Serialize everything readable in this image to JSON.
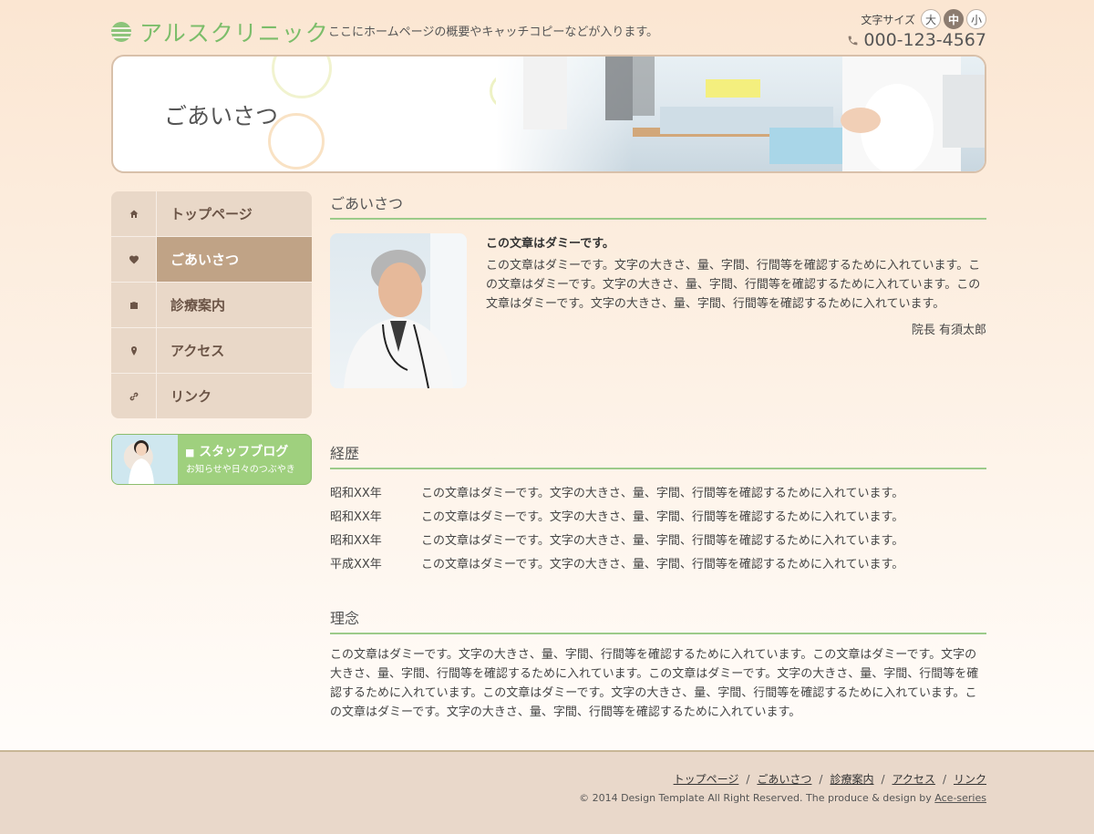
{
  "header": {
    "logo_text": "アルスクリニック",
    "catch_copy": "ここにホームページの概要やキャッチコピーなどが入ります。",
    "font_size_label": "文字サイズ",
    "font_sizes": [
      "大",
      "中",
      "小"
    ],
    "font_size_active": "中",
    "phone": "000-123-4567"
  },
  "banner": {
    "title": "ごあいさつ"
  },
  "nav": {
    "items": [
      {
        "label": "トップページ",
        "icon": "home-icon"
      },
      {
        "label": "ごあいさつ",
        "icon": "heart-icon",
        "current": true
      },
      {
        "label": "診療案内",
        "icon": "briefcase-icon"
      },
      {
        "label": "アクセス",
        "icon": "map-pin-icon"
      },
      {
        "label": "リンク",
        "icon": "link-icon"
      }
    ]
  },
  "blog_banner": {
    "title": "スタッフブログ",
    "subtitle": "お知らせや日々のつぶやき"
  },
  "greeting": {
    "heading": "ごあいさつ",
    "title": "この文章はダミーです。",
    "body": "この文章はダミーです。文字の大きさ、量、字間、行間等を確認するために入れています。この文章はダミーです。文字の大きさ、量、字間、行間等を確認するために入れています。この文章はダミーです。文字の大きさ、量、字間、行間等を確認するために入れています。",
    "signature": "院長 有須太郎"
  },
  "history": {
    "heading": "経歴",
    "rows": [
      {
        "year": "昭和XX年",
        "text": "この文章はダミーです。文字の大きさ、量、字間、行間等を確認するために入れています。"
      },
      {
        "year": "昭和XX年",
        "text": "この文章はダミーです。文字の大きさ、量、字間、行間等を確認するために入れています。"
      },
      {
        "year": "昭和XX年",
        "text": "この文章はダミーです。文字の大きさ、量、字間、行間等を確認するために入れています。"
      },
      {
        "year": "平成XX年",
        "text": "この文章はダミーです。文字の大きさ、量、字間、行間等を確認するために入れています。"
      }
    ]
  },
  "philosophy": {
    "heading": "理念",
    "body": "この文章はダミーです。文字の大きさ、量、字間、行間等を確認するために入れています。この文章はダミーです。文字の大きさ、量、字間、行間等を確認するために入れています。この文章はダミーです。文字の大きさ、量、字間、行間等を確認するために入れています。この文章はダミーです。文字の大きさ、量、字間、行間等を確認するために入れています。この文章はダミーです。文字の大きさ、量、字間、行間等を確認するために入れています。"
  },
  "footer": {
    "links": [
      "トップページ",
      "ごあいさつ",
      "診療案内",
      "アクセス",
      "リンク"
    ],
    "separator": "/",
    "copyright": "© 2014 Design Template All Right Reserved. The produce & design by ",
    "credit_link": "Ace-series"
  },
  "colors": {
    "accent_green": "#7cbd6a",
    "nav_current": "#c0a386",
    "nav_bg": "#e9d8c8"
  }
}
